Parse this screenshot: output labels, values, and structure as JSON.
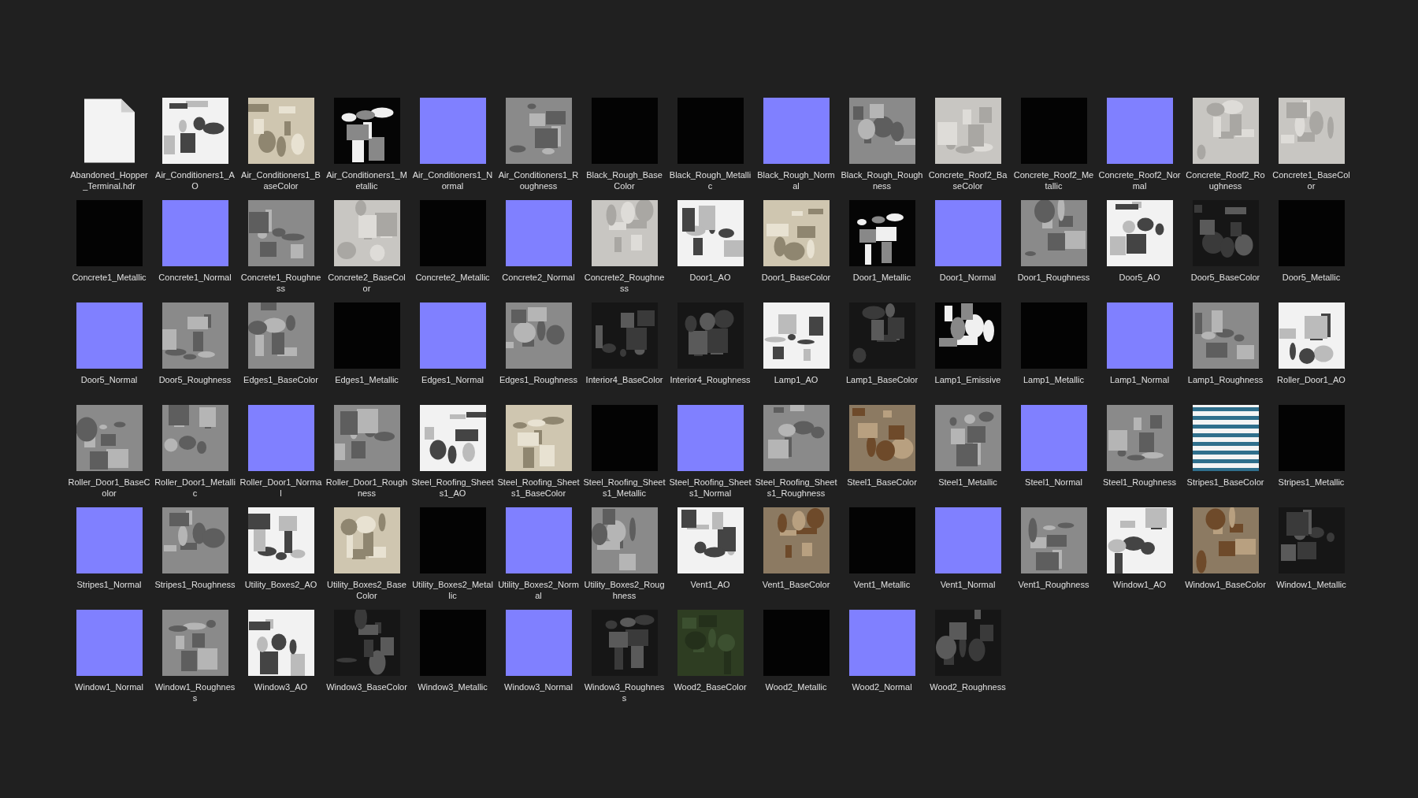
{
  "files": [
    {
      "name": "Abandoned_Hopper_Terminal.hdr",
      "kind": "document"
    },
    {
      "name": "Air_Conditioners1_AO",
      "kind": "white"
    },
    {
      "name": "Air_Conditioners1_BaseColor",
      "kind": "beige"
    },
    {
      "name": "Air_Conditioners1_Metallic",
      "kind": "mask"
    },
    {
      "name": "Air_Conditioners1_Normal",
      "kind": "normal"
    },
    {
      "name": "Air_Conditioners1_Roughness",
      "kind": "grey"
    },
    {
      "name": "Black_Rough_BaseColor",
      "kind": "black"
    },
    {
      "name": "Black_Rough_Metallic",
      "kind": "black"
    },
    {
      "name": "Black_Rough_Normal",
      "kind": "normal"
    },
    {
      "name": "Black_Rough_Roughness",
      "kind": "grey"
    },
    {
      "name": "Concrete_Roof2_BaseColor",
      "kind": "light"
    },
    {
      "name": "Concrete_Roof2_Metallic",
      "kind": "black"
    },
    {
      "name": "Concrete_Roof2_Normal",
      "kind": "normal"
    },
    {
      "name": "Concrete_Roof2_Roughness",
      "kind": "light"
    },
    {
      "name": "Concrete1_BaseColor",
      "kind": "light"
    },
    {
      "name": "Concrete1_Metallic",
      "kind": "black"
    },
    {
      "name": "Concrete1_Normal",
      "kind": "normal"
    },
    {
      "name": "Concrete1_Roughness",
      "kind": "grey"
    },
    {
      "name": "Concrete2_BaseColor",
      "kind": "light"
    },
    {
      "name": "Concrete2_Metallic",
      "kind": "black"
    },
    {
      "name": "Concrete2_Normal",
      "kind": "normal"
    },
    {
      "name": "Concrete2_Roughness",
      "kind": "light"
    },
    {
      "name": "Door1_AO",
      "kind": "white"
    },
    {
      "name": "Door1_BaseColor",
      "kind": "beige"
    },
    {
      "name": "Door1_Metallic",
      "kind": "mask"
    },
    {
      "name": "Door1_Normal",
      "kind": "normal"
    },
    {
      "name": "Door1_Roughness",
      "kind": "grey"
    },
    {
      "name": "Door5_AO",
      "kind": "white"
    },
    {
      "name": "Door5_BaseColor",
      "kind": "dark"
    },
    {
      "name": "Door5_Metallic",
      "kind": "black"
    },
    {
      "name": "Door5_Normal",
      "kind": "normal"
    },
    {
      "name": "Door5_Roughness",
      "kind": "grey"
    },
    {
      "name": "Edges1_BaseColor",
      "kind": "grey"
    },
    {
      "name": "Edges1_Metallic",
      "kind": "black"
    },
    {
      "name": "Edges1_Normal",
      "kind": "normal"
    },
    {
      "name": "Edges1_Roughness",
      "kind": "grey"
    },
    {
      "name": "Interior4_BaseColor",
      "kind": "dark"
    },
    {
      "name": "Interior4_Roughness",
      "kind": "dark"
    },
    {
      "name": "Lamp1_AO",
      "kind": "white"
    },
    {
      "name": "Lamp1_BaseColor",
      "kind": "dark"
    },
    {
      "name": "Lamp1_Emissive",
      "kind": "mask"
    },
    {
      "name": "Lamp1_Metallic",
      "kind": "black"
    },
    {
      "name": "Lamp1_Normal",
      "kind": "normal"
    },
    {
      "name": "Lamp1_Roughness",
      "kind": "grey"
    },
    {
      "name": "Roller_Door1_AO",
      "kind": "white"
    },
    {
      "name": "Roller_Door1_BaseColor",
      "kind": "grey"
    },
    {
      "name": "Roller_Door1_Metallic",
      "kind": "grey"
    },
    {
      "name": "Roller_Door1_Normal",
      "kind": "normal"
    },
    {
      "name": "Roller_Door1_Roughness",
      "kind": "grey"
    },
    {
      "name": "Steel_Roofing_Sheets1_AO",
      "kind": "white"
    },
    {
      "name": "Steel_Roofing_Sheets1_BaseColor",
      "kind": "beige"
    },
    {
      "name": "Steel_Roofing_Sheets1_Metallic",
      "kind": "black"
    },
    {
      "name": "Steel_Roofing_Sheets1_Normal",
      "kind": "normal"
    },
    {
      "name": "Steel_Roofing_Sheets1_Roughness",
      "kind": "grey"
    },
    {
      "name": "Steel1_BaseColor",
      "kind": "rust"
    },
    {
      "name": "Steel1_Metallic",
      "kind": "grey"
    },
    {
      "name": "Steel1_Normal",
      "kind": "normal"
    },
    {
      "name": "Steel1_Roughness",
      "kind": "grey"
    },
    {
      "name": "Stripes1_BaseColor",
      "kind": "stripes"
    },
    {
      "name": "Stripes1_Metallic",
      "kind": "black"
    },
    {
      "name": "Stripes1_Normal",
      "kind": "normal"
    },
    {
      "name": "Stripes1_Roughness",
      "kind": "grey"
    },
    {
      "name": "Utility_Boxes2_AO",
      "kind": "white"
    },
    {
      "name": "Utility_Boxes2_BaseColor",
      "kind": "beige"
    },
    {
      "name": "Utility_Boxes2_Metallic",
      "kind": "black"
    },
    {
      "name": "Utility_Boxes2_Normal",
      "kind": "normal"
    },
    {
      "name": "Utility_Boxes2_Roughness",
      "kind": "grey"
    },
    {
      "name": "Vent1_AO",
      "kind": "white"
    },
    {
      "name": "Vent1_BaseColor",
      "kind": "rust"
    },
    {
      "name": "Vent1_Metallic",
      "kind": "black"
    },
    {
      "name": "Vent1_Normal",
      "kind": "normal"
    },
    {
      "name": "Vent1_Roughness",
      "kind": "grey"
    },
    {
      "name": "Window1_AO",
      "kind": "white"
    },
    {
      "name": "Window1_BaseColor",
      "kind": "rust"
    },
    {
      "name": "Window1_Metallic",
      "kind": "dark"
    },
    {
      "name": "Window1_Normal",
      "kind": "normal"
    },
    {
      "name": "Window1_Roughness",
      "kind": "grey"
    },
    {
      "name": "Window3_AO",
      "kind": "white"
    },
    {
      "name": "Window3_BaseColor",
      "kind": "dark"
    },
    {
      "name": "Window3_Metallic",
      "kind": "black"
    },
    {
      "name": "Window3_Normal",
      "kind": "normal"
    },
    {
      "name": "Window3_Roughness",
      "kind": "dark"
    },
    {
      "name": "Wood2_BaseColor",
      "kind": "green"
    },
    {
      "name": "Wood2_Metallic",
      "kind": "black"
    },
    {
      "name": "Wood2_Normal",
      "kind": "normal"
    },
    {
      "name": "Wood2_Roughness",
      "kind": "dark"
    }
  ]
}
